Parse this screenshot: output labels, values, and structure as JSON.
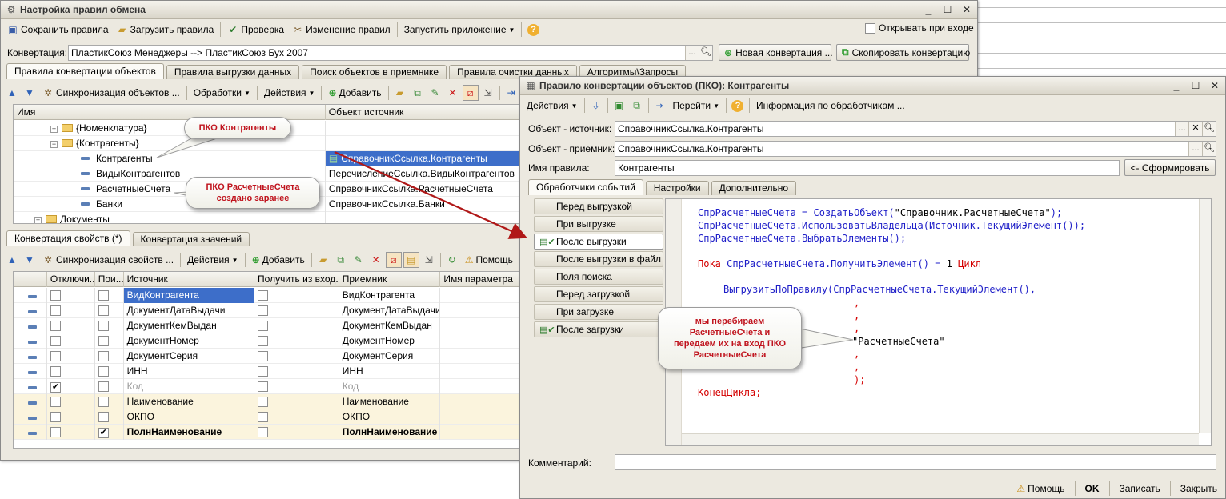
{
  "main_window": {
    "title": "Настройка правил обмена",
    "toolbar": {
      "save_rules": "Сохранить правила",
      "load_rules": "Загрузить правила",
      "check": "Проверка",
      "change_rules": "Изменение правил",
      "run_app": "Запустить приложение",
      "open_on_login": "Открывать при входе"
    },
    "conversion_label": "Конвертация:",
    "conversion_value": "ПластикСоюз Менеджеры --> ПластикСоюз Бух 2007",
    "new_conversion": "Новая конвертация ...",
    "copy_conversion": "Скопировать конвертацию",
    "tabs": [
      "Правила конвертации объектов",
      "Правила выгрузки данных",
      "Поиск объектов в приемнике",
      "Правила очистки данных",
      "Алгоритмы\\Запросы"
    ],
    "rules_toolbar": {
      "sync": "Синхронизация объектов ...",
      "processing": "Обработки",
      "actions": "Действия",
      "add": "Добавить"
    },
    "rules_grid": {
      "col_name": "Имя",
      "col_source": "Объект источник",
      "rows": [
        {
          "name": "{Номенклатура}",
          "source": "",
          "type": "folder-collapsed"
        },
        {
          "name": "{Контрагенты}",
          "source": "",
          "type": "folder-expanded"
        },
        {
          "name": "Контрагенты",
          "source": "СправочникСсылка.Контрагенты",
          "type": "item-selected"
        },
        {
          "name": "ВидыКонтрагентов",
          "source": "ПеречислениеСсылка.ВидыКонтрагентов",
          "type": "item"
        },
        {
          "name": "РасчетныеСчета",
          "source": "СправочникСсылка.РасчетныеСчета",
          "type": "item"
        },
        {
          "name": "Банки",
          "source": "СправочникСсылка.Банки",
          "type": "item"
        },
        {
          "name": "Документы",
          "source": "",
          "type": "folder-collapsed"
        }
      ]
    },
    "lower_tabs": [
      "Конвертация свойств (*)",
      "Конвертация значений"
    ],
    "props_toolbar": {
      "sync": "Синхронизация свойств ...",
      "actions": "Действия",
      "add": "Добавить",
      "help": "Помощь"
    },
    "props_grid": {
      "cols": [
        "Отключи...",
        "Пои...",
        "Источник",
        "Получить из вход...",
        "Приемник",
        "Имя параметра"
      ],
      "rows": [
        {
          "disabled": false,
          "search": false,
          "source": "ВидКонтрагента",
          "receiver": "ВидКонтрагента",
          "hl": false,
          "bold": false,
          "gray": false,
          "sel": true
        },
        {
          "disabled": false,
          "search": false,
          "source": "ДокументДатаВыдачи",
          "receiver": "ДокументДатаВыдачи",
          "hl": false,
          "bold": false,
          "gray": false,
          "sel": false
        },
        {
          "disabled": false,
          "search": false,
          "source": "ДокументКемВыдан",
          "receiver": "ДокументКемВыдан",
          "hl": false,
          "bold": false,
          "gray": false,
          "sel": false
        },
        {
          "disabled": false,
          "search": false,
          "source": "ДокументНомер",
          "receiver": "ДокументНомер",
          "hl": false,
          "bold": false,
          "gray": false,
          "sel": false
        },
        {
          "disabled": false,
          "search": false,
          "source": "ДокументСерия",
          "receiver": "ДокументСерия",
          "hl": false,
          "bold": false,
          "gray": false,
          "sel": false
        },
        {
          "disabled": false,
          "search": false,
          "source": "ИНН",
          "receiver": "ИНН",
          "hl": false,
          "bold": false,
          "gray": false,
          "sel": false
        },
        {
          "disabled": true,
          "search": false,
          "source": "Код",
          "receiver": "Код",
          "hl": false,
          "bold": false,
          "gray": true,
          "sel": false
        },
        {
          "disabled": false,
          "search": false,
          "source": "Наименование",
          "receiver": "Наименование",
          "hl": true,
          "bold": false,
          "gray": false,
          "sel": false
        },
        {
          "disabled": false,
          "search": false,
          "source": "ОКПО",
          "receiver": "ОКПО",
          "hl": true,
          "bold": false,
          "gray": false,
          "sel": false
        },
        {
          "disabled": false,
          "search": true,
          "source": "ПолнНаименование",
          "receiver": "ПолнНаименование",
          "hl": true,
          "bold": true,
          "gray": false,
          "sel": false
        }
      ]
    }
  },
  "dialog": {
    "title": "Правило конвертации объектов (ПКО): Контрагенты",
    "toolbar": {
      "actions": "Действия",
      "goto": "Перейти",
      "handlers_info": "Информация по обработчикам ..."
    },
    "source_label": "Объект - источник:",
    "source_value": "СправочникСсылка.Контрагенты",
    "receiver_label": "Объект - приемник:",
    "receiver_value": "СправочникСсылка.Контрагенты",
    "rule_name_label": "Имя правила:",
    "rule_name_value": "Контрагенты",
    "form_button": "<- Сформировать",
    "tabs": [
      "Обработчики событий",
      "Настройки",
      "Дополнительно"
    ],
    "events": [
      {
        "label": "Перед выгрузкой",
        "has_icon": false,
        "active": false
      },
      {
        "label": "При выгрузке",
        "has_icon": false,
        "active": false
      },
      {
        "label": "После выгрузки",
        "has_icon": true,
        "active": true
      },
      {
        "label": "После выгрузки в файл",
        "has_icon": false,
        "active": false
      },
      {
        "label": "Поля поиска",
        "has_icon": false,
        "active": false
      },
      {
        "label": "Перед загрузкой",
        "has_icon": false,
        "active": false
      },
      {
        "label": "При загрузке",
        "has_icon": false,
        "active": false
      },
      {
        "label": "После загрузки",
        "has_icon": true,
        "active": false
      }
    ],
    "code": {
      "l1a": "СпрРасчетныеСчета = СоздатьОбъект(",
      "l1s": "\"Справочник.РасчетныеСчета\"",
      "l1b": ");",
      "l2": "СпрРасчетныеСчета.ИспользоватьВладельца(Источник.ТекущийЭлемент());",
      "l3": "СпрРасчетныеСчета.ВыбратьЭлементы();",
      "l4k1": "Пока",
      "l4a": " СпрРасчетныеСчета.ПолучитьЭлемент() = ",
      "l4n": "1",
      "l4k2": " Цикл",
      "l5": "ВыгрузитьПоПравилу(СпрРасчетныеСчета.ТекущийЭлемент(),",
      "comma": ",",
      "l9s": "\"РасчетныеСчета\"",
      "close": ");",
      "end": "КонецЦикла;"
    },
    "comment_label": "Комментарий:",
    "bottom": {
      "help": "Помощь",
      "ok": "OK",
      "write": "Записать",
      "close": "Закрыть"
    }
  },
  "callouts": {
    "pko_contragents": "ПКО Контрагенты",
    "pko_accounts_l1": "ПКО РасчетныеСчета",
    "pko_accounts_l2": "создано заранее",
    "loop_l1": "мы перебираем",
    "loop_l2": "РасчетныеСчета и",
    "loop_l3": "передаем их на вход ПКО",
    "loop_l4": "РасчетныеСчета"
  },
  "colors": {
    "selection": "#3d6ec9",
    "callout_text": "#c0141e",
    "arrow": "#b01818",
    "keyword": "#d40000",
    "code_text": "#1e1ec8"
  }
}
